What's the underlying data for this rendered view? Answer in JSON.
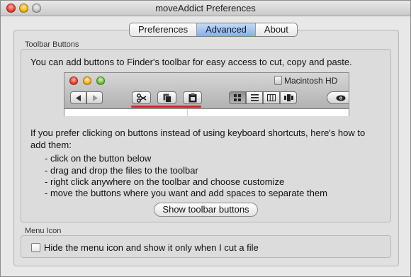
{
  "window": {
    "title": "moveAddict Preferences"
  },
  "tabs": [
    {
      "label": "Preferences"
    },
    {
      "label": "Advanced",
      "active": true
    },
    {
      "label": "About"
    }
  ],
  "toolbar_section": {
    "label": "Toolbar Buttons",
    "intro": "You can add buttons to Finder's toolbar for easy access to cut, copy and paste.",
    "finder_preview": {
      "volume_title": "Macintosh HD",
      "nav_icons": [
        "back-arrow-icon",
        "forward-arrow-icon"
      ],
      "added_buttons": [
        "scissors-icon",
        "copy-pages-icon",
        "paste-clipboard-icon"
      ],
      "view_icons": [
        "icon-view-icon",
        "list-view-icon",
        "column-view-icon",
        "coverflow-view-icon"
      ],
      "quicklook_icon": "eye-icon",
      "highlight_color": "#d0262b"
    },
    "explanation_line1": "If you prefer clicking on buttons instead of using keyboard shortcuts, here's how to",
    "explanation_line2": "add them:",
    "steps": [
      "- click on the button below",
      "- drag and drop the files to the toolbar",
      "- right click anywhere on the toolbar and choose customize",
      "- move the buttons where you want and add spaces to separate them"
    ],
    "show_button_label": "Show toolbar buttons"
  },
  "menu_section": {
    "label": "Menu Icon",
    "checkbox_label": "Hide the menu icon and show it only when I cut a file",
    "checked": false
  },
  "colors": {
    "active_tab": "#86b1e8",
    "window_bg": "#e8e8e8"
  }
}
